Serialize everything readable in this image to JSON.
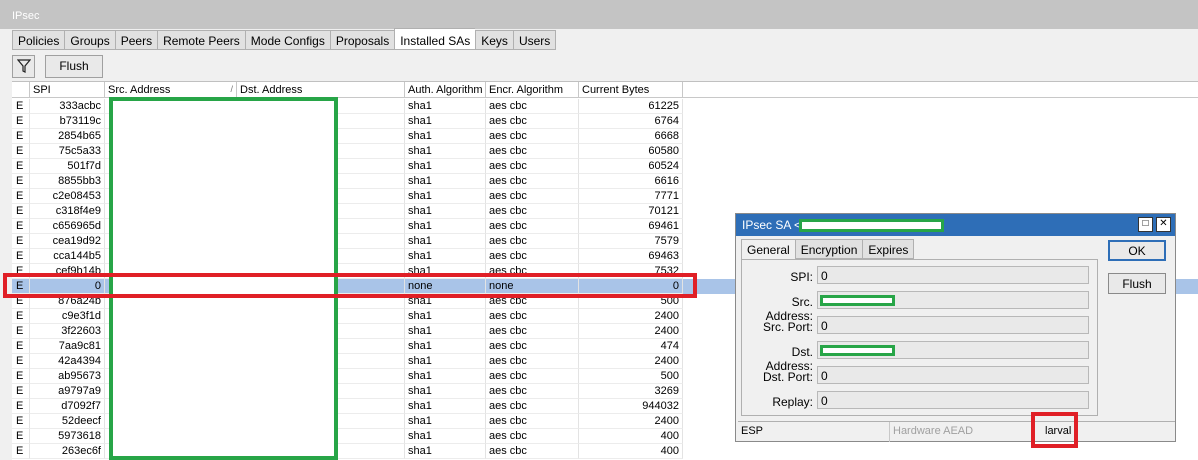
{
  "window": {
    "title": "IPsec"
  },
  "tabs": [
    {
      "label": "Policies",
      "active": false
    },
    {
      "label": "Groups",
      "active": false
    },
    {
      "label": "Peers",
      "active": false
    },
    {
      "label": "Remote Peers",
      "active": false
    },
    {
      "label": "Mode Configs",
      "active": false
    },
    {
      "label": "Proposals",
      "active": false
    },
    {
      "label": "Installed SAs",
      "active": true
    },
    {
      "label": "Keys",
      "active": false
    },
    {
      "label": "Users",
      "active": false
    }
  ],
  "toolbar": {
    "filter_icon": "filter-icon",
    "flush_label": "Flush"
  },
  "table": {
    "columns": {
      "spi": "SPI",
      "src": "Src. Address",
      "dst": "Dst. Address",
      "auth": "Auth. Algorithm",
      "enc": "Encr. Algorithm",
      "bytes": "Current Bytes"
    },
    "rows": [
      {
        "flag": "E",
        "spi": "333acbc",
        "auth": "sha1",
        "enc": "aes cbc",
        "bytes": "61225"
      },
      {
        "flag": "E",
        "spi": "b73119c",
        "auth": "sha1",
        "enc": "aes cbc",
        "bytes": "6764"
      },
      {
        "flag": "E",
        "spi": "2854b65",
        "auth": "sha1",
        "enc": "aes cbc",
        "bytes": "6668"
      },
      {
        "flag": "E",
        "spi": "75c5a33",
        "auth": "sha1",
        "enc": "aes cbc",
        "bytes": "60580"
      },
      {
        "flag": "E",
        "spi": "501f7d",
        "auth": "sha1",
        "enc": "aes cbc",
        "bytes": "60524"
      },
      {
        "flag": "E",
        "spi": "8855bb3",
        "auth": "sha1",
        "enc": "aes cbc",
        "bytes": "6616"
      },
      {
        "flag": "E",
        "spi": "c2e08453",
        "auth": "sha1",
        "enc": "aes cbc",
        "bytes": "7771"
      },
      {
        "flag": "E",
        "spi": "c318f4e9",
        "auth": "sha1",
        "enc": "aes cbc",
        "bytes": "70121"
      },
      {
        "flag": "E",
        "spi": "c656965d",
        "auth": "sha1",
        "enc": "aes cbc",
        "bytes": "69461"
      },
      {
        "flag": "E",
        "spi": "cea19d92",
        "auth": "sha1",
        "enc": "aes cbc",
        "bytes": "7579"
      },
      {
        "flag": "E",
        "spi": "cca144b5",
        "auth": "sha1",
        "enc": "aes cbc",
        "bytes": "69463"
      },
      {
        "flag": "E",
        "spi": "cef9b14b",
        "auth": "sha1",
        "enc": "aes cbc",
        "bytes": "7532"
      },
      {
        "flag": "E",
        "spi": "0",
        "auth": "none",
        "enc": "none",
        "bytes": "0",
        "selected": true
      },
      {
        "flag": "E",
        "spi": "876a24b",
        "auth": "sha1",
        "enc": "aes cbc",
        "bytes": "500"
      },
      {
        "flag": "E",
        "spi": "c9e3f1d",
        "auth": "sha1",
        "enc": "aes cbc",
        "bytes": "2400"
      },
      {
        "flag": "E",
        "spi": "3f22603",
        "auth": "sha1",
        "enc": "aes cbc",
        "bytes": "2400"
      },
      {
        "flag": "E",
        "spi": "7aa9c81",
        "auth": "sha1",
        "enc": "aes cbc",
        "bytes": "474"
      },
      {
        "flag": "E",
        "spi": "42a4394",
        "auth": "sha1",
        "enc": "aes cbc",
        "bytes": "2400"
      },
      {
        "flag": "E",
        "spi": "ab95673",
        "auth": "sha1",
        "enc": "aes cbc",
        "bytes": "500"
      },
      {
        "flag": "E",
        "spi": "a9797a9",
        "auth": "sha1",
        "enc": "aes cbc",
        "bytes": "3269"
      },
      {
        "flag": "E",
        "spi": "d7092f7",
        "auth": "sha1",
        "enc": "aes cbc",
        "bytes": "944032"
      },
      {
        "flag": "E",
        "spi": "52deecf",
        "auth": "sha1",
        "enc": "aes cbc",
        "bytes": "2400"
      },
      {
        "flag": "E",
        "spi": "5973618",
        "auth": "sha1",
        "enc": "aes cbc",
        "bytes": "400"
      },
      {
        "flag": "E",
        "spi": "263ec6f",
        "auth": "sha1",
        "enc": "aes cbc",
        "bytes": "400"
      }
    ]
  },
  "dialog": {
    "title": "IPsec SA <",
    "tabs": [
      "General",
      "Encryption",
      "Expires"
    ],
    "fields": {
      "spi": {
        "label": "SPI:",
        "value": "0"
      },
      "src_address": {
        "label": "Src. Address:",
        "value": ""
      },
      "src_port": {
        "label": "Src. Port:",
        "value": "0"
      },
      "dst_address": {
        "label": "Dst. Address:",
        "value": ""
      },
      "dst_port": {
        "label": "Dst. Port:",
        "value": "0"
      },
      "replay": {
        "label": "Replay:",
        "value": "0"
      }
    },
    "ok_label": "OK",
    "flush_label": "Flush",
    "status": {
      "protocol": "ESP",
      "hardware": "Hardware AEAD",
      "state": "larval"
    }
  },
  "colors": {
    "redaction": "#27a547",
    "highlight": "#e01f26",
    "selected_row": "#a9c4e8",
    "title_bar": "#2e6eb7"
  }
}
